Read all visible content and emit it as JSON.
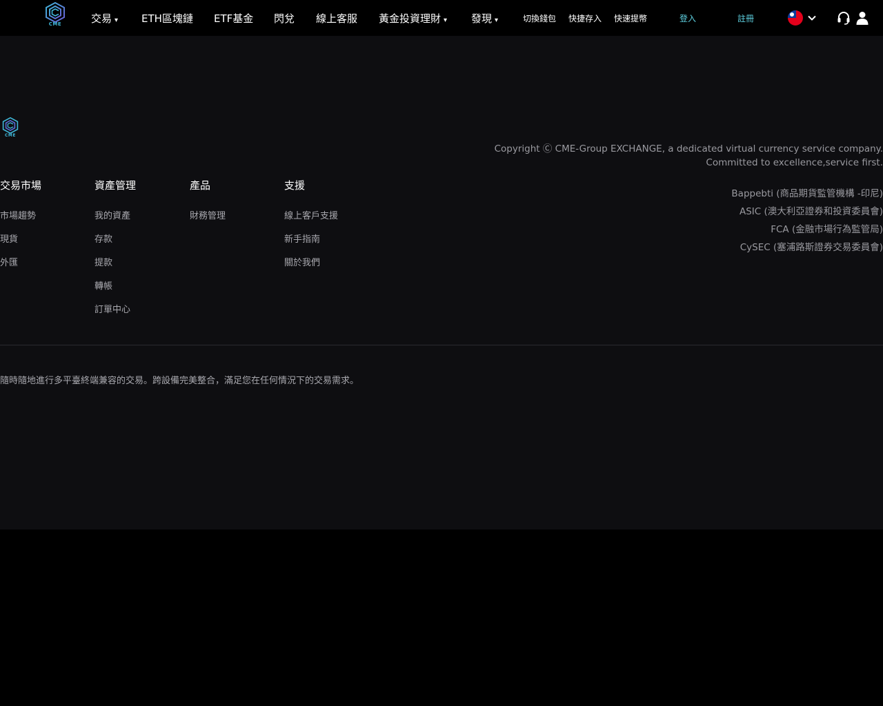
{
  "brand": {
    "logo_text": "CME",
    "accent_color": "#3fb6d8"
  },
  "nav": {
    "trade": "交易",
    "eth_chain": "ETH區塊鏈",
    "etf": "ETF基金",
    "swap": "閃兌",
    "support": "線上客服",
    "gold": "黃金投資理財",
    "discover": "發現",
    "switch_wallet": "切換錢包",
    "quick_deposit": "快捷存入",
    "quick_withdraw": "快速提幣",
    "login": "登入",
    "register": "註冊",
    "caret": "▾"
  },
  "icons": {
    "language_flag": "taiwan-flag-icon",
    "language_caret": "chevron-down-icon",
    "service": "headset-icon",
    "user": "user-icon"
  },
  "footer": {
    "logo_text": "CME",
    "columns": [
      {
        "title": "交易市場",
        "links": [
          "市場趨勢",
          "現貨",
          "外匯"
        ]
      },
      {
        "title": "資產管理",
        "links": [
          "我的資產",
          "存款",
          "提款",
          "轉帳",
          "訂單中心"
        ]
      },
      {
        "title": "產品",
        "links": [
          "財務管理"
        ]
      },
      {
        "title": "支援",
        "links": [
          "線上客戶支援",
          "新手指南",
          "關於我們"
        ]
      }
    ],
    "copyright_line1": "Copyright Ⓒ CME-Group EXCHANGE, a dedicated virtual currency service company.",
    "copyright_line2": "Committed to excellence,service first.",
    "regulators": [
      "Bappebti (商品期貨監管機構 -印尼)",
      "ASIC (澳大利亞證券和投資委員會)",
      "FCA (金融市場行為監管局)",
      "CySEC (塞浦路斯證券交易委員會)"
    ],
    "tagline": "隨時隨地進行多平臺終端兼容的交易。跨設備完美整合，滿足您在任何情況下的交易需求。"
  }
}
